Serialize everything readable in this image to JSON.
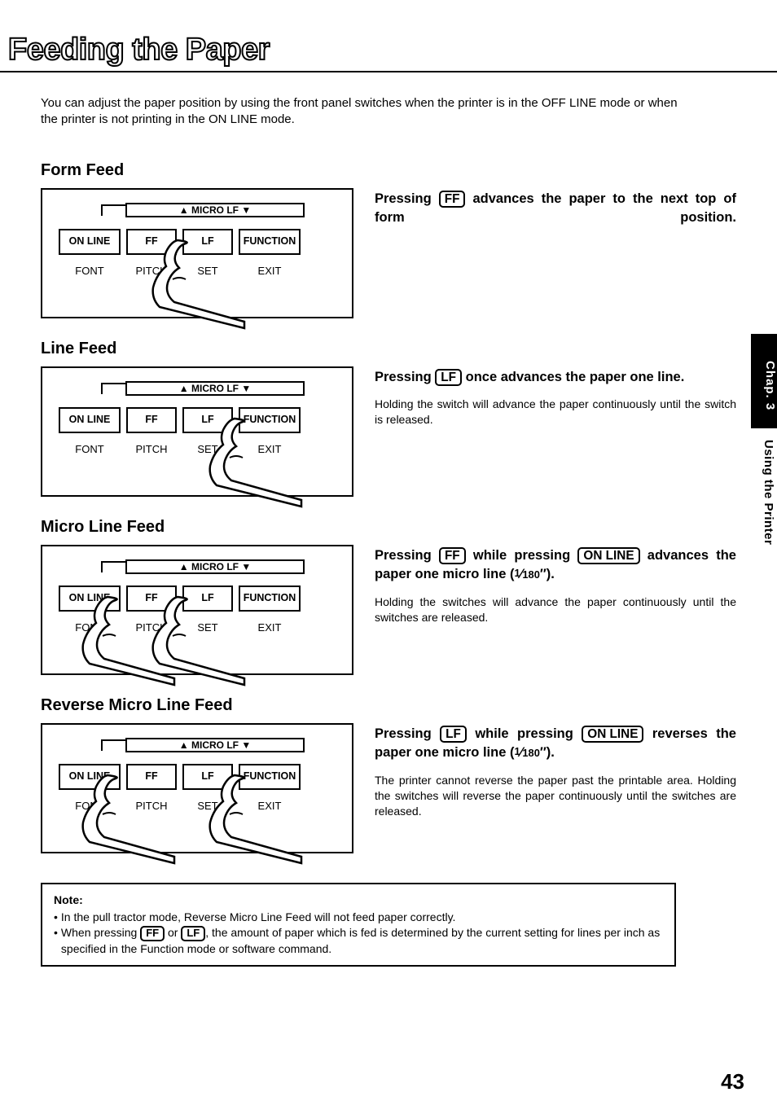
{
  "title": "Feeding the Paper",
  "intro": "You can adjust the paper position by using the front panel switches when the printer is in the OFF LINE mode or when the printer is not printing in the ON LINE mode.",
  "panel": {
    "microlf": "▲ MICRO LF ▼",
    "buttons": {
      "online": "ON LINE",
      "ff": "FF",
      "lf": "LF",
      "function": "FUNCTION"
    },
    "labels": {
      "font": "FONT",
      "pitch": "PITCH",
      "set": "SET",
      "exit": "EXIT"
    }
  },
  "keys": {
    "ff": "FF",
    "lf": "LF",
    "online": "ON LINE"
  },
  "sections": {
    "form_feed": {
      "heading": "Form Feed",
      "right_pre": "Pressing ",
      "right_post": " advances the paper to the next top of form position."
    },
    "line_feed": {
      "heading": "Line Feed",
      "right_pre": "Pressing ",
      "right_post": " once advances the paper one line.",
      "body": "Holding the switch will advance the paper continuously until the switch is released."
    },
    "micro_line_feed": {
      "heading": "Micro Line Feed",
      "right_pre": "Pressing ",
      "right_mid": " while pressing ",
      "right_post_a": " advances the paper one micro line (",
      "right_post_b": ").",
      "body": "Holding the switches will advance the paper continuously until the switches are released."
    },
    "reverse_micro_line_feed": {
      "heading": "Reverse Micro Line Feed",
      "right_pre": "Pressing ",
      "right_mid": " while pressing ",
      "right_post_a": " reverses the paper one micro line (",
      "right_post_b": ").",
      "body": "The printer cannot reverse the paper past the printable area. Holding the switches will reverse the paper continuously until the switches are released."
    }
  },
  "fraction": {
    "num": "1",
    "den": "180",
    "unit": "″"
  },
  "note": {
    "title": "Note:",
    "b1": "In the pull tractor mode, Reverse Micro Line Feed will not feed paper correctly.",
    "b2_pre": "When pressing ",
    "b2_mid": " or ",
    "b2_post": ", the amount of paper which is fed is determined by the current setting for lines per inch as specified in the Function mode or software command."
  },
  "side": {
    "chap": "Chap. 3",
    "label": "Using the Printer"
  },
  "page_number": "43"
}
